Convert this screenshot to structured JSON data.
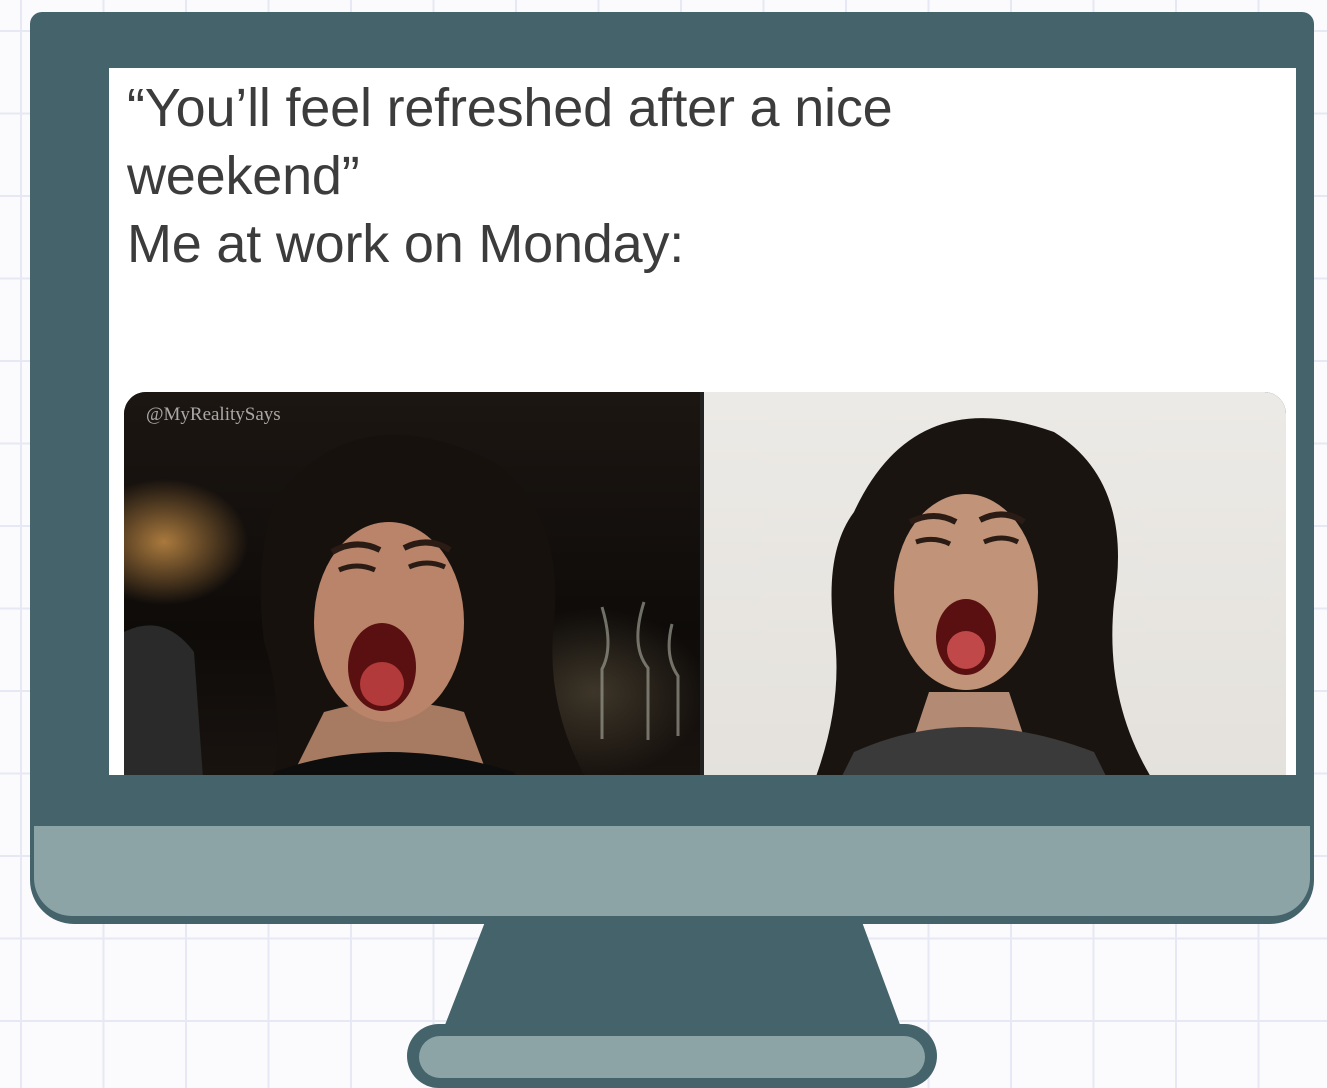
{
  "meme": {
    "caption_lines": [
      "“You’ll feel refreshed after a nice",
      "weekend”",
      "Me at work on Monday:"
    ],
    "watermark": "@MyRealitySays"
  },
  "colors": {
    "monitor_frame": "#44636b",
    "monitor_chin": "#8da4a7",
    "stand": "#44636b",
    "grid_background": "#fbfbfd",
    "grid_lines": "#e6e9f4",
    "screen_background": "#ffffff",
    "caption_text": "#3c3c3c"
  },
  "icons": [
    "desktop-monitor-illustration"
  ]
}
